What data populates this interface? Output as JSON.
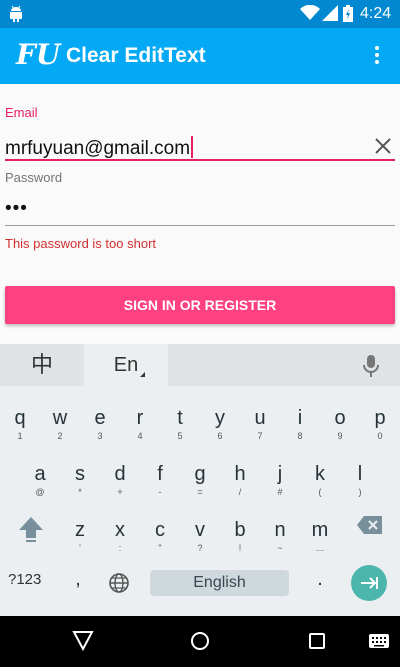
{
  "status_bar": {
    "time": "4:24",
    "icons": [
      "android-icon",
      "wifi-icon",
      "signal-icon",
      "battery-icon"
    ]
  },
  "app_bar": {
    "logo_text": "FU",
    "title": "Clear EditText",
    "overflow_icon": "more-vert-icon"
  },
  "form": {
    "email_label": "Email",
    "email_value": "mrfuyuan@gmail.com",
    "clear_icon": "close-icon",
    "password_label": "Password",
    "password_value": "•••",
    "error_message": "This password is too short",
    "submit_label": "SIGN IN OR REGISTER"
  },
  "keyboard": {
    "lang_chinese": "中",
    "lang_english": "En",
    "mic_icon": "microphone-icon",
    "rows": [
      [
        {
          "m": "q",
          "s": "1"
        },
        {
          "m": "w",
          "s": "2"
        },
        {
          "m": "e",
          "s": "3"
        },
        {
          "m": "r",
          "s": "4"
        },
        {
          "m": "t",
          "s": "5"
        },
        {
          "m": "y",
          "s": "6"
        },
        {
          "m": "u",
          "s": "7"
        },
        {
          "m": "i",
          "s": "8"
        },
        {
          "m": "o",
          "s": "9"
        },
        {
          "m": "p",
          "s": "0"
        }
      ],
      [
        {
          "m": "a",
          "s": "@"
        },
        {
          "m": "s",
          "s": "*"
        },
        {
          "m": "d",
          "s": "+"
        },
        {
          "m": "f",
          "s": "-"
        },
        {
          "m": "g",
          "s": "="
        },
        {
          "m": "h",
          "s": "/"
        },
        {
          "m": "j",
          "s": "#"
        },
        {
          "m": "k",
          "s": "("
        },
        {
          "m": "l",
          "s": ")"
        }
      ],
      [
        {
          "m": "z",
          "s": "'"
        },
        {
          "m": "x",
          "s": ":"
        },
        {
          "m": "c",
          "s": "\""
        },
        {
          "m": "v",
          "s": "?"
        },
        {
          "m": "b",
          "s": "!"
        },
        {
          "m": "n",
          "s": "~"
        },
        {
          "m": "m",
          "s": "…"
        }
      ]
    ],
    "numbers_key": "?123",
    "comma_key": ",",
    "space_label": "English",
    "period_key": "."
  },
  "nav_bar": {
    "icons": [
      "back-icon",
      "home-icon",
      "recents-icon",
      "keyboard-switch-icon"
    ]
  }
}
